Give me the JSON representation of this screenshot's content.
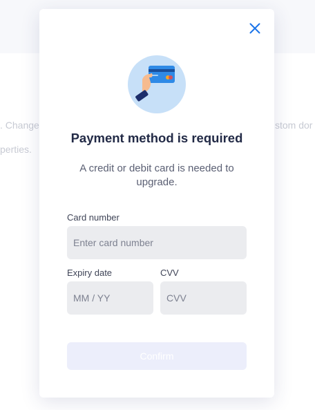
{
  "background": {
    "text_left_1": ". Change",
    "text_left_2": "perties.",
    "text_right_1": "stom dor"
  },
  "modal": {
    "title": "Payment method is required",
    "subtitle": "A credit or debit card is needed to upgrade.",
    "card_number": {
      "label": "Card number",
      "placeholder": "Enter card number",
      "value": ""
    },
    "expiry": {
      "label": "Expiry date",
      "placeholder": "MM / YY",
      "value": ""
    },
    "cvv": {
      "label": "CVV",
      "placeholder": "CVV",
      "value": ""
    },
    "confirm_label": "Confirm",
    "close_icon": "close-icon",
    "illustration_icon": "hand-holding-card-icon"
  },
  "colors": {
    "accent": "#1a73e8",
    "title": "#222a46",
    "input_bg": "#ebecef",
    "confirm_disabled_bg": "#eceefb"
  }
}
